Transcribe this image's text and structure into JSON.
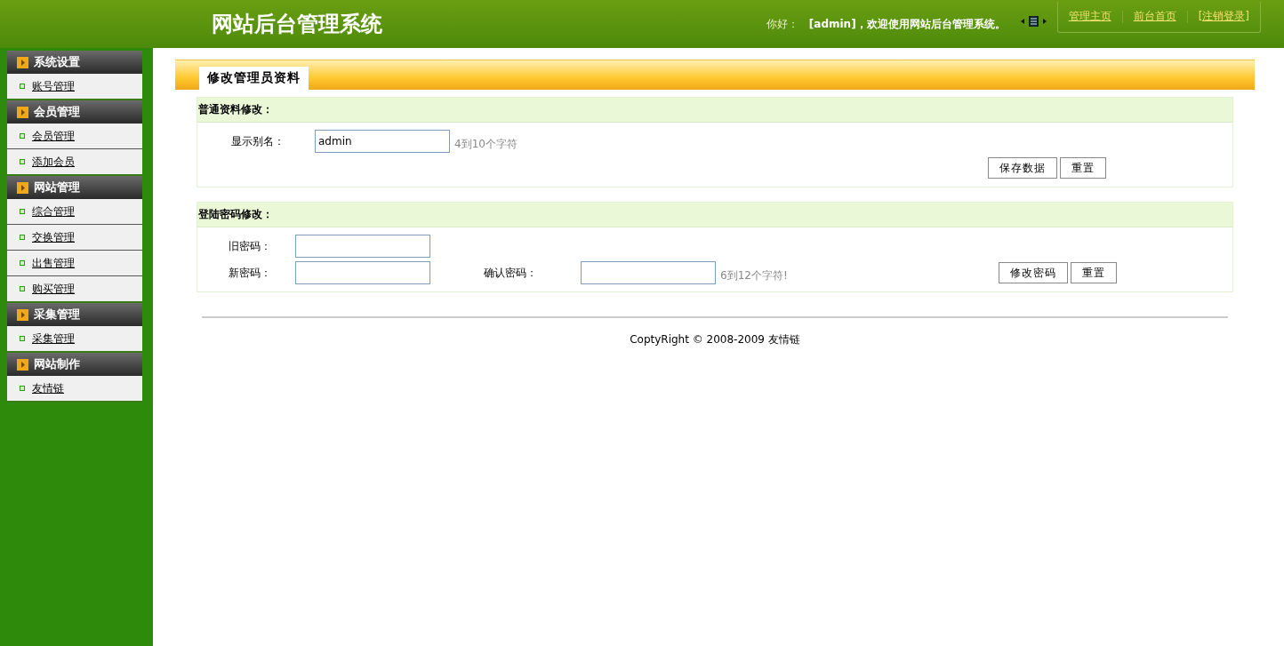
{
  "header": {
    "title": "网站后台管理系统",
    "greeting": "你好：",
    "welcome": "[admin]，欢迎使用网站后台管理系统。",
    "links": [
      {
        "label": "管理主页"
      },
      {
        "label": "前台首页"
      },
      {
        "label": "[注销登录]"
      }
    ]
  },
  "sidebar": {
    "groups": [
      {
        "title": "系统设置",
        "items": [
          {
            "label": "账号管理"
          }
        ]
      },
      {
        "title": "会员管理",
        "items": [
          {
            "label": "会员管理"
          },
          {
            "label": "添加会员"
          }
        ]
      },
      {
        "title": "网站管理",
        "items": [
          {
            "label": "综合管理"
          },
          {
            "label": "交换管理"
          },
          {
            "label": "出售管理"
          },
          {
            "label": "购买管理"
          }
        ]
      },
      {
        "title": "采集管理",
        "items": [
          {
            "label": "采集管理"
          }
        ]
      },
      {
        "title": "网站制作",
        "items": [
          {
            "label": "友情链"
          }
        ]
      }
    ]
  },
  "page_tab": {
    "label": "修改管理员资料"
  },
  "sections": [
    {
      "title": "普通资料修改：",
      "rows": [
        {
          "fields": [
            {
              "label": "显示别名：",
              "value": "admin",
              "hint": "4到10个字符"
            }
          ],
          "buttons": []
        },
        {
          "fields": [],
          "buttons": [
            "保存数据",
            "重置"
          ]
        }
      ]
    },
    {
      "title": "登陆密码修改：",
      "rows": [
        {
          "fields": [
            {
              "label": "旧密码："
            }
          ],
          "buttons": []
        },
        {
          "fields": [
            {
              "label": "新密码："
            },
            {
              "label": "确认密码：",
              "hint": "6到12个字符!"
            }
          ],
          "buttons": [
            "修改密码",
            "重置"
          ]
        }
      ]
    }
  ],
  "footer": "CoptyRight © 2008-2009 友情链"
}
